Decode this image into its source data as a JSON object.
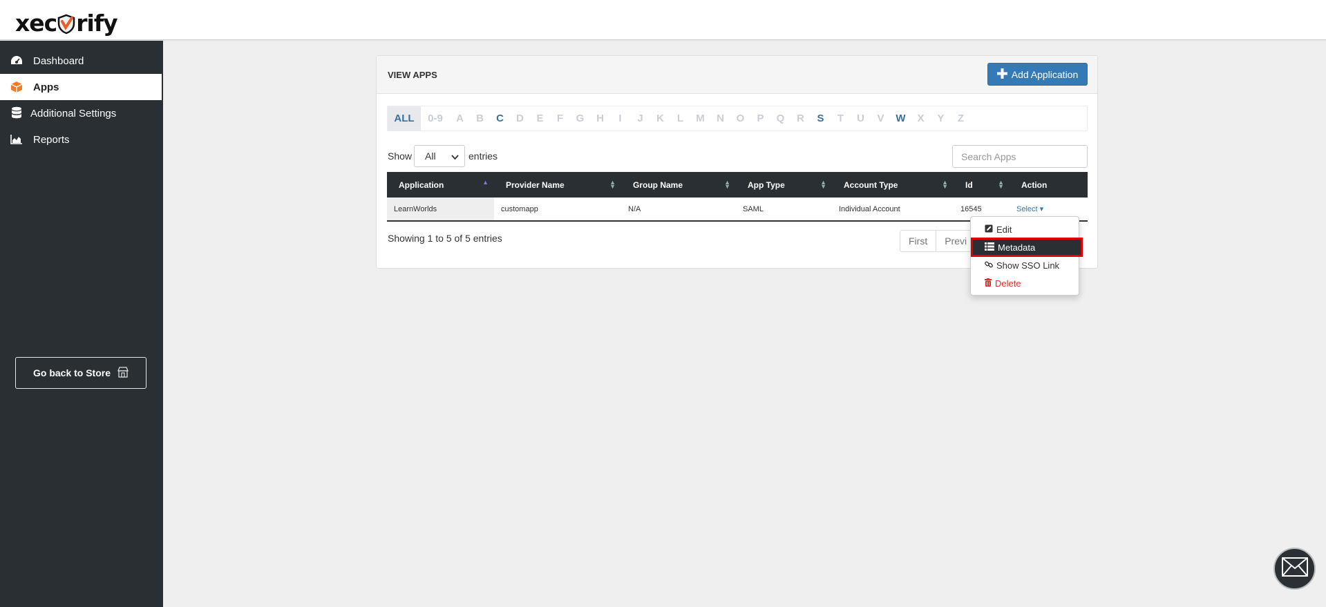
{
  "brand": {
    "logo_left": "xec",
    "logo_right": "rify"
  },
  "sidebar": {
    "items": [
      {
        "label": "Dashboard",
        "icon": "dashboard-icon"
      },
      {
        "label": "Apps",
        "icon": "box-icon"
      },
      {
        "label": "Additional Settings",
        "icon": "database-icon"
      },
      {
        "label": "Reports",
        "icon": "chart-icon"
      }
    ],
    "store_button": "Go back to Store"
  },
  "panel": {
    "title": "VIEW APPS",
    "add_button": "Add Application"
  },
  "alphabet": [
    "ALL",
    "0-9",
    "A",
    "B",
    "C",
    "D",
    "E",
    "F",
    "G",
    "H",
    "I",
    "J",
    "K",
    "L",
    "M",
    "N",
    "O",
    "P",
    "Q",
    "R",
    "S",
    "T",
    "U",
    "V",
    "W",
    "X",
    "Y",
    "Z"
  ],
  "alphabet_active": [
    "ALL",
    "C",
    "S",
    "W"
  ],
  "length": {
    "show_label": "Show",
    "value": "All",
    "entries_label": "entries"
  },
  "search": {
    "placeholder": "Search Apps"
  },
  "table": {
    "columns": [
      "Application",
      "Provider Name",
      "Group Name",
      "App Type",
      "Account Type",
      "Id",
      "Action"
    ],
    "rows": [
      {
        "application": "LearnWorlds",
        "provider": "customapp",
        "group": "N/A",
        "type": "SAML",
        "account": "Individual Account",
        "id": "16545",
        "action": "Select"
      }
    ]
  },
  "info": "Showing 1 to 5 of 5 entries",
  "pager": {
    "first": "First",
    "previous": "Previ"
  },
  "dropdown": {
    "edit": "Edit",
    "metadata": "Metadata",
    "sso": "Show SSO Link",
    "delete": "Delete"
  },
  "colors": {
    "accent": "#337ab7",
    "sidebar": "#2a2f33",
    "highlight": "#e00000",
    "danger": "#d9302c"
  }
}
